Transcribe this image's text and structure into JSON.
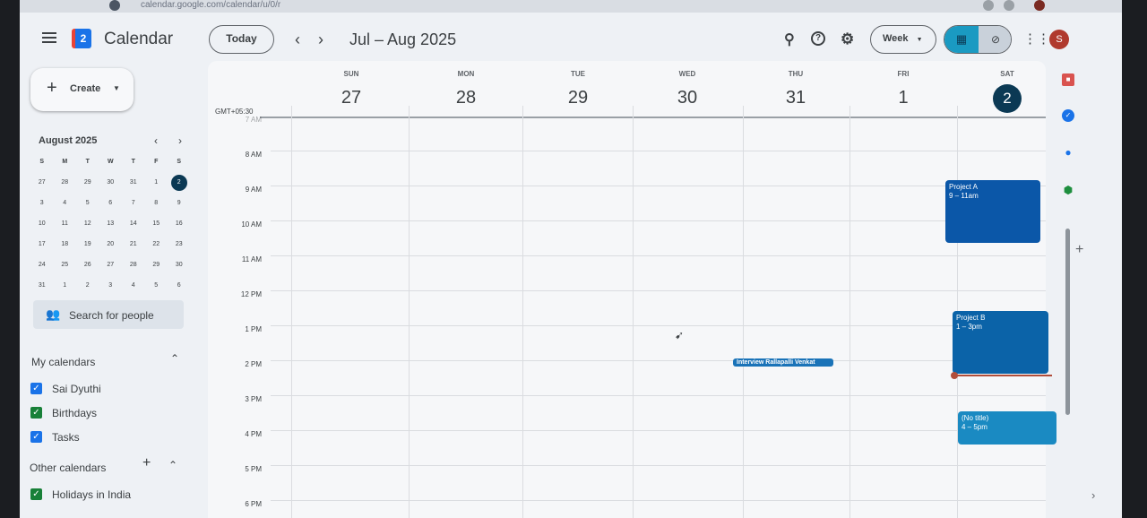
{
  "browser": {
    "url": "calendar.google.com/calendar/u/0/r"
  },
  "topbar": {
    "app_title": "Calendar",
    "logo_text": "2",
    "today_label": "Today",
    "prev_icon": "chevron-left-icon",
    "next_icon": "chevron-right-icon",
    "date_range": "Jul – Aug 2025",
    "view_label": "Week",
    "avatar_letter": "S",
    "accent_color": "#0b3954",
    "toggle_color": "#1a9ac2"
  },
  "sidebar": {
    "create_label": "Create",
    "mini_calendar": {
      "title": "August 2025",
      "weekdays": [
        "S",
        "M",
        "T",
        "W",
        "T",
        "F",
        "S"
      ],
      "weeks": [
        [
          "27",
          "28",
          "29",
          "30",
          "31",
          "1",
          "2"
        ],
        [
          "3",
          "4",
          "5",
          "6",
          "7",
          "8",
          "9"
        ],
        [
          "10",
          "11",
          "12",
          "13",
          "14",
          "15",
          "16"
        ],
        [
          "17",
          "18",
          "19",
          "20",
          "21",
          "22",
          "23"
        ],
        [
          "24",
          "25",
          "26",
          "27",
          "28",
          "29",
          "30"
        ],
        [
          "31",
          "1",
          "2",
          "3",
          "4",
          "5",
          "6"
        ]
      ],
      "selected": "2"
    },
    "search_people": "Search for people",
    "my_calendars_title": "My calendars",
    "my_calendars": [
      {
        "label": "Sai Dyuthi",
        "color": "#1a73e8"
      },
      {
        "label": "Birthdays",
        "color": "#188038"
      },
      {
        "label": "Tasks",
        "color": "#1a73e8"
      }
    ],
    "other_calendars_title": "Other calendars",
    "other_calendars": [
      {
        "label": "Holidays in India",
        "color": "#188038"
      }
    ]
  },
  "week": {
    "timezone": "GMT+05:30",
    "days": [
      {
        "dow": "SUN",
        "num": "27"
      },
      {
        "dow": "MON",
        "num": "28"
      },
      {
        "dow": "TUE",
        "num": "29"
      },
      {
        "dow": "WED",
        "num": "30"
      },
      {
        "dow": "THU",
        "num": "31"
      },
      {
        "dow": "FRI",
        "num": "1"
      },
      {
        "dow": "SAT",
        "num": "2",
        "today": true
      }
    ],
    "hours": [
      "7 AM",
      "8 AM",
      "9 AM",
      "10 AM",
      "11 AM",
      "12 PM",
      "1 PM",
      "2 PM",
      "3 PM",
      "4 PM",
      "5 PM",
      "6 PM"
    ]
  },
  "events": {
    "project_a": {
      "title": "Project A",
      "time": "9 – 11am",
      "color": "#0b57a8"
    },
    "project_b": {
      "title": "Project B",
      "time": "1 – 3pm",
      "color": "#0b63a8"
    },
    "no_title": {
      "title": "(No title)",
      "time": "4 – 5pm",
      "color": "#1a8ac2"
    },
    "interview": {
      "title": "Interview Rallapalli Venkat",
      "color": "#1a73b8"
    }
  }
}
